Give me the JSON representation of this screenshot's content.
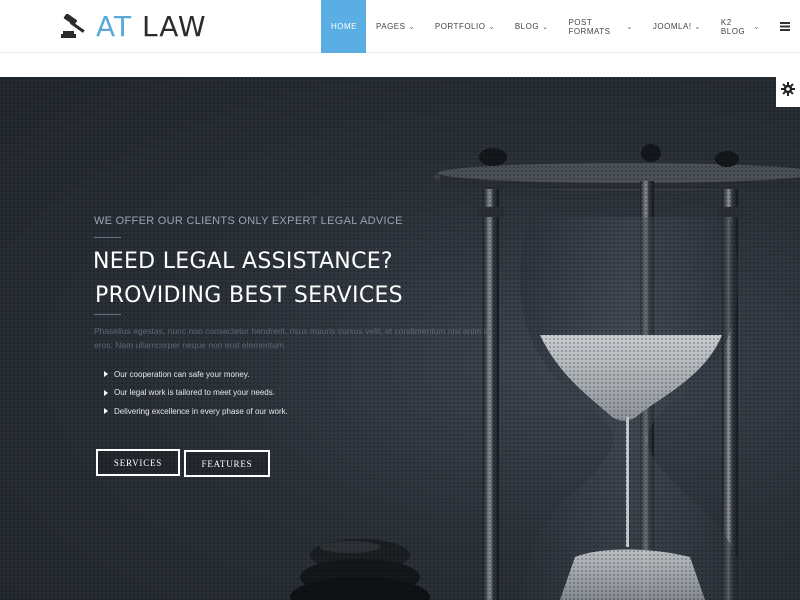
{
  "brand": {
    "prefix": "AT",
    "name": "LAW"
  },
  "nav": {
    "items": [
      {
        "label": "HOME",
        "active": true,
        "dropdown": false
      },
      {
        "label": "PAGES",
        "active": false,
        "dropdown": true
      },
      {
        "label": "PORTFOLIO",
        "active": false,
        "dropdown": true
      },
      {
        "label": "BLOG",
        "active": false,
        "dropdown": true
      },
      {
        "label": "POST FORMATS",
        "active": false,
        "dropdown": true
      },
      {
        "label": "JOOMLA!",
        "active": false,
        "dropdown": true
      },
      {
        "label": "K2 BLOG",
        "active": false,
        "dropdown": true
      }
    ],
    "menu_icon": "hamburger-icon"
  },
  "hero": {
    "tagline": "WE OFFER OUR CLIENTS ONLY EXPERT LEGAL ADVICE",
    "headline_1": "NEED LEGAL ASSISTANCE?",
    "headline_2": "PROVIDING BEST SERVICES",
    "paragraph": "Phasellus egestas, nunc non consectetur hendrerit, risus mauris cursus velit, et condimentum nisi enim in eros. Nam ullamcorper neque non erat elementum.",
    "bullets": [
      "Our cooperation can safe your money.",
      "Our legal work is tailored to meet your needs.",
      "Delivering excellence in every phase of our work."
    ],
    "buttons": {
      "services": "SERVICES",
      "features": "FEATURES"
    }
  },
  "icons": {
    "logo": "gavel-icon",
    "settings": "gear-icon",
    "bullet": "triangle-right-icon"
  },
  "colors": {
    "accent": "#5aaee3",
    "hero_bg": "#2c323a",
    "text_dark": "#2b2b2b"
  }
}
